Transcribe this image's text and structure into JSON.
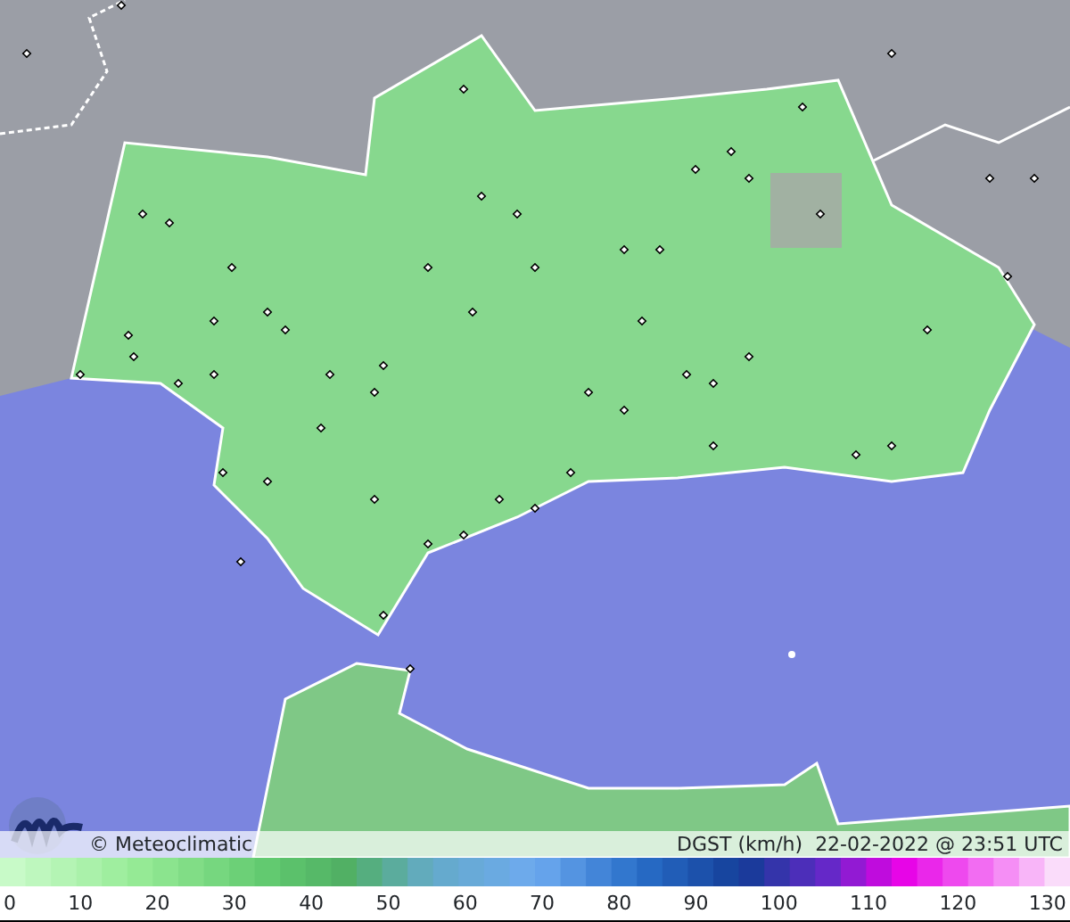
{
  "map": {
    "credit": "© Meteoclimatic",
    "variable": "DGST (km/h)",
    "timestamp": "22-02-2022 @ 23:51 UTC"
  },
  "legend": {
    "ticks": [
      "0",
      "10",
      "20",
      "30",
      "40",
      "50",
      "60",
      "70",
      "80",
      "90",
      "100",
      "110",
      "120",
      "130"
    ]
  }
}
